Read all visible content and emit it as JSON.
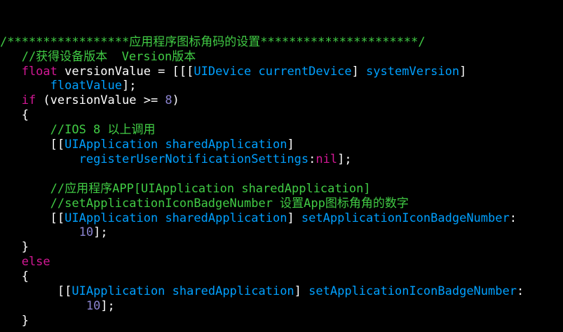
{
  "colors": {
    "background": "#000000",
    "plain": "#ffffff",
    "comment": "#41cc45",
    "keyword": "#d31895",
    "type": "#00a0ff",
    "number": "#8b84cf"
  },
  "code": {
    "lines": [
      [
        {
          "c": "comment",
          "t": "/*****************应用程序图标角码的设置**********************/"
        }
      ],
      [
        {
          "c": "comment",
          "t": "   //获得设备版本  Version版本"
        }
      ],
      [
        {
          "c": "keyword",
          "t": "   float"
        },
        {
          "c": "plain",
          "t": " versionValue = [[["
        },
        {
          "c": "type",
          "t": "UIDevice"
        },
        {
          "c": "plain",
          "t": " "
        },
        {
          "c": "type",
          "t": "currentDevice"
        },
        {
          "c": "plain",
          "t": "] "
        },
        {
          "c": "type",
          "t": "systemVersion"
        },
        {
          "c": "plain",
          "t": "]"
        }
      ],
      [
        {
          "c": "plain",
          "t": "       "
        },
        {
          "c": "type",
          "t": "floatValue"
        },
        {
          "c": "plain",
          "t": "];"
        }
      ],
      [
        {
          "c": "keyword",
          "t": "   if"
        },
        {
          "c": "plain",
          "t": " (versionValue >= "
        },
        {
          "c": "number",
          "t": "8"
        },
        {
          "c": "plain",
          "t": ")"
        }
      ],
      [
        {
          "c": "plain",
          "t": "   {"
        }
      ],
      [
        {
          "c": "comment",
          "t": "       //IOS 8 以上调用"
        }
      ],
      [
        {
          "c": "plain",
          "t": "       [["
        },
        {
          "c": "type",
          "t": "UIApplication"
        },
        {
          "c": "plain",
          "t": " "
        },
        {
          "c": "type",
          "t": "sharedApplication"
        },
        {
          "c": "plain",
          "t": "]"
        }
      ],
      [
        {
          "c": "plain",
          "t": "           "
        },
        {
          "c": "type",
          "t": "registerUserNotificationSettings"
        },
        {
          "c": "plain",
          "t": ":"
        },
        {
          "c": "keyword",
          "t": "nil"
        },
        {
          "c": "plain",
          "t": "];"
        }
      ],
      [
        {
          "c": "plain",
          "t": " "
        }
      ],
      [
        {
          "c": "comment",
          "t": "       //应用程序APP[UIApplication sharedApplication]"
        }
      ],
      [
        {
          "c": "comment",
          "t": "       //setApplicationIconBadgeNumber 设置App图标角角的数字"
        }
      ],
      [
        {
          "c": "plain",
          "t": "       [["
        },
        {
          "c": "type",
          "t": "UIApplication"
        },
        {
          "c": "plain",
          "t": " "
        },
        {
          "c": "type",
          "t": "sharedApplication"
        },
        {
          "c": "plain",
          "t": "] "
        },
        {
          "c": "type",
          "t": "setApplicationIconBadgeNumber"
        },
        {
          "c": "plain",
          "t": ":"
        }
      ],
      [
        {
          "c": "plain",
          "t": "           "
        },
        {
          "c": "number",
          "t": "10"
        },
        {
          "c": "plain",
          "t": "];"
        }
      ],
      [
        {
          "c": "plain",
          "t": "   }"
        }
      ],
      [
        {
          "c": "keyword",
          "t": "   else"
        }
      ],
      [
        {
          "c": "plain",
          "t": "   {"
        }
      ],
      [
        {
          "c": "plain",
          "t": "        [["
        },
        {
          "c": "type",
          "t": "UIApplication"
        },
        {
          "c": "plain",
          "t": " "
        },
        {
          "c": "type",
          "t": "sharedApplication"
        },
        {
          "c": "plain",
          "t": "] "
        },
        {
          "c": "type",
          "t": "setApplicationIconBadgeNumber"
        },
        {
          "c": "plain",
          "t": ":"
        }
      ],
      [
        {
          "c": "plain",
          "t": "            "
        },
        {
          "c": "number",
          "t": "10"
        },
        {
          "c": "plain",
          "t": "];"
        }
      ],
      [
        {
          "c": "plain",
          "t": "   }"
        }
      ]
    ]
  }
}
